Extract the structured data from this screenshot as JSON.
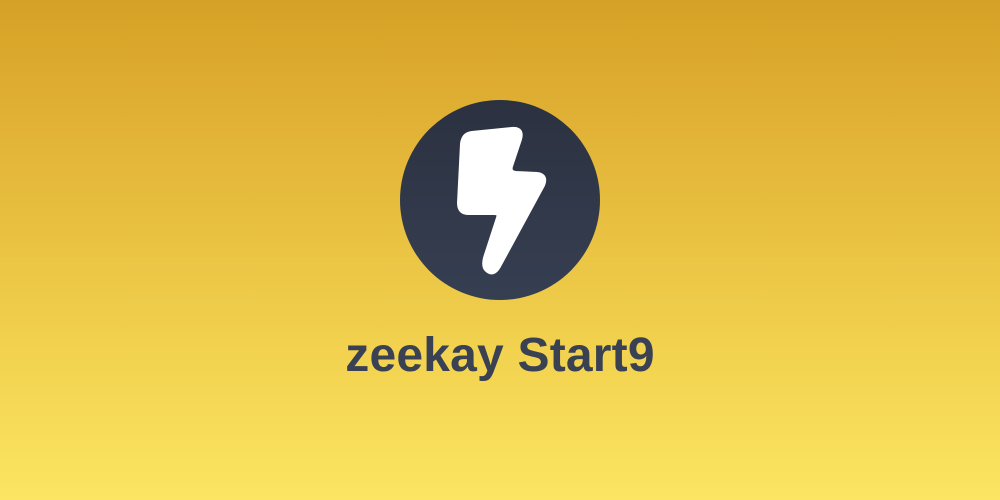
{
  "brand": {
    "name": "zeekay Start9",
    "logo_icon": "lightning-bolt-icon"
  },
  "colors": {
    "background_top": "#d6a126",
    "background_bottom": "#fbe562",
    "logo_circle": "#2f3646",
    "bolt": "#ffffff",
    "title_text": "#3a4152"
  }
}
